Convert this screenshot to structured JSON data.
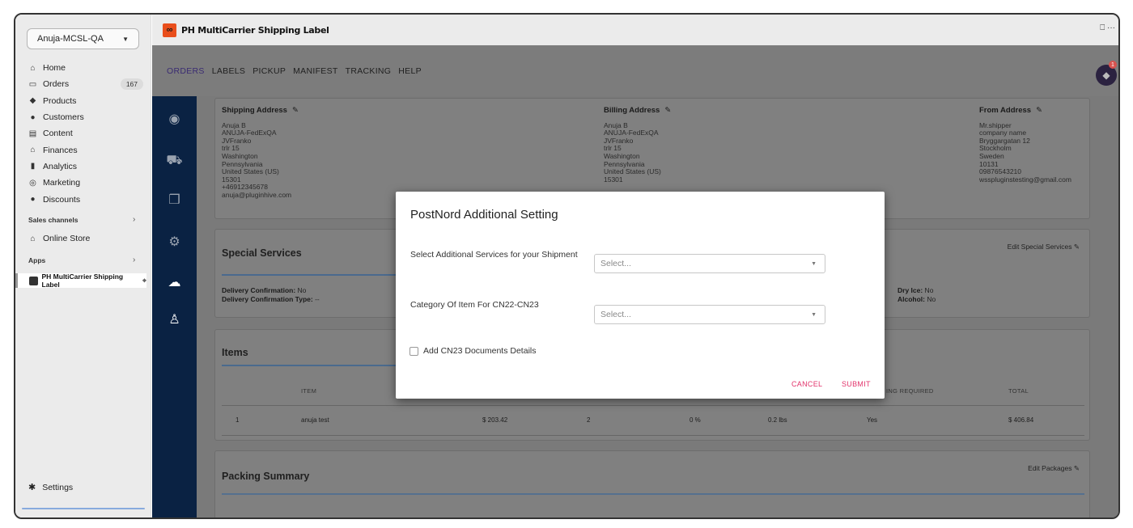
{
  "sidebar": {
    "store": "Anuja-MCSL-QA",
    "items": [
      {
        "label": "Home",
        "icon": "home-icon",
        "glyph": "⌂"
      },
      {
        "label": "Orders",
        "icon": "orders-icon",
        "glyph": "▭",
        "badge": "167"
      },
      {
        "label": "Products",
        "icon": "tag-icon",
        "glyph": "◆"
      },
      {
        "label": "Customers",
        "icon": "person-icon",
        "glyph": "●"
      },
      {
        "label": "Content",
        "icon": "content-icon",
        "glyph": "▤"
      },
      {
        "label": "Finances",
        "icon": "bank-icon",
        "glyph": "⌂"
      },
      {
        "label": "Analytics",
        "icon": "bar-chart-icon",
        "glyph": "▮"
      },
      {
        "label": "Marketing",
        "icon": "target-icon",
        "glyph": "◎"
      },
      {
        "label": "Discounts",
        "icon": "discount-icon",
        "glyph": "●"
      }
    ],
    "sales_channels": "Sales channels",
    "online_store": "Online Store",
    "apps": "Apps",
    "app_item": "PH MultiCarrier Shipping Label",
    "settings": "Settings"
  },
  "app": {
    "title": "PH MultiCarrier Shipping Label",
    "top_right": "⎕ ···",
    "menu": [
      "ORDERS",
      "LABELS",
      "PICKUP",
      "MANIFEST",
      "TRACKING",
      "HELP"
    ],
    "notification_count": "1"
  },
  "addresses": {
    "shipping": {
      "title": "Shipping Address",
      "lines": [
        "Anuja B",
        "ANUJA-FedExQA",
        "JVFranko",
        "trlr 15",
        "Washington",
        "Pennsylvania",
        "United States (US)",
        "15301",
        "+46912345678",
        "anuja@pluginhive.com"
      ]
    },
    "billing": {
      "title": "Billing Address",
      "lines": [
        "Anuja B",
        "ANUJA-FedExQA",
        "JVFranko",
        "trlr 15",
        "Washington",
        "Pennsylvania",
        "United States (US)",
        "15301"
      ]
    },
    "from": {
      "title": "From Address",
      "lines": [
        "Mr.shipper",
        "company name",
        "Bryggargatan 12",
        "Stockholm",
        "Sweden",
        "10131",
        "09876543210",
        "wsspluginstesting@gmail.com"
      ]
    }
  },
  "special": {
    "title": "Special Services",
    "edit": "Edit Special Services",
    "delivery_confirmation_label": "Delivery Confirmation:",
    "delivery_confirmation_value": " No",
    "delivery_confirmation_type_label": "Delivery Confirmation Type:",
    "delivery_confirmation_type_value": " --",
    "dry_ice_label": "Dry Ice:",
    "dry_ice_value": " No",
    "alcohol_label": "Alcohol:",
    "alcohol_value": " No"
  },
  "items": {
    "title": "Items",
    "headers": {
      "item": "ITEM",
      "shipping_required": "ING REQUIRED",
      "total": "TOTAL"
    },
    "row": {
      "index": "1",
      "name": "anuja test",
      "price": "$ 203.42",
      "qty": "2",
      "discount": "0 %",
      "weight": "0.2 lbs",
      "required": "Yes",
      "total": "$ 406.84"
    }
  },
  "packing": {
    "title": "Packing Summary",
    "edit": "Edit Packages"
  },
  "modal": {
    "title": "PostNord Additional Setting",
    "services_label": "Select Additional Services for your Shipment",
    "services_placeholder": "Select...",
    "category_label": "Category Of Item For CN22-CN23",
    "category_placeholder": "Select...",
    "cn23_label": "Add CN23 Documents Details",
    "cancel": "CANCEL",
    "submit": "SUBMIT"
  }
}
